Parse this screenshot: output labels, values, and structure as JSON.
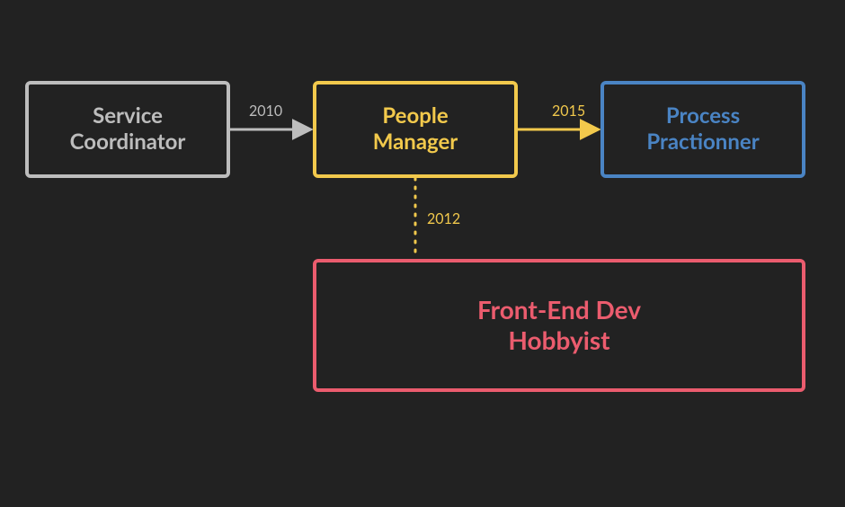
{
  "nodes": {
    "service": {
      "label": "Service\nCoordinator",
      "color": "#BDBDBD"
    },
    "people": {
      "label": "People\nManager",
      "color": "#F2C94C"
    },
    "process": {
      "label": "Process\nPractionner",
      "color": "#4A84C4"
    },
    "frontend": {
      "label": "Front-End Dev\nHobbyist",
      "color": "#EB5C6E"
    }
  },
  "edges": {
    "service_to_people": {
      "year": "2010",
      "color": "#BDBDBD"
    },
    "people_to_process": {
      "year": "2015",
      "color": "#F2C94C"
    },
    "people_to_frontend": {
      "year": "2012",
      "color": "#F2C94C"
    }
  }
}
